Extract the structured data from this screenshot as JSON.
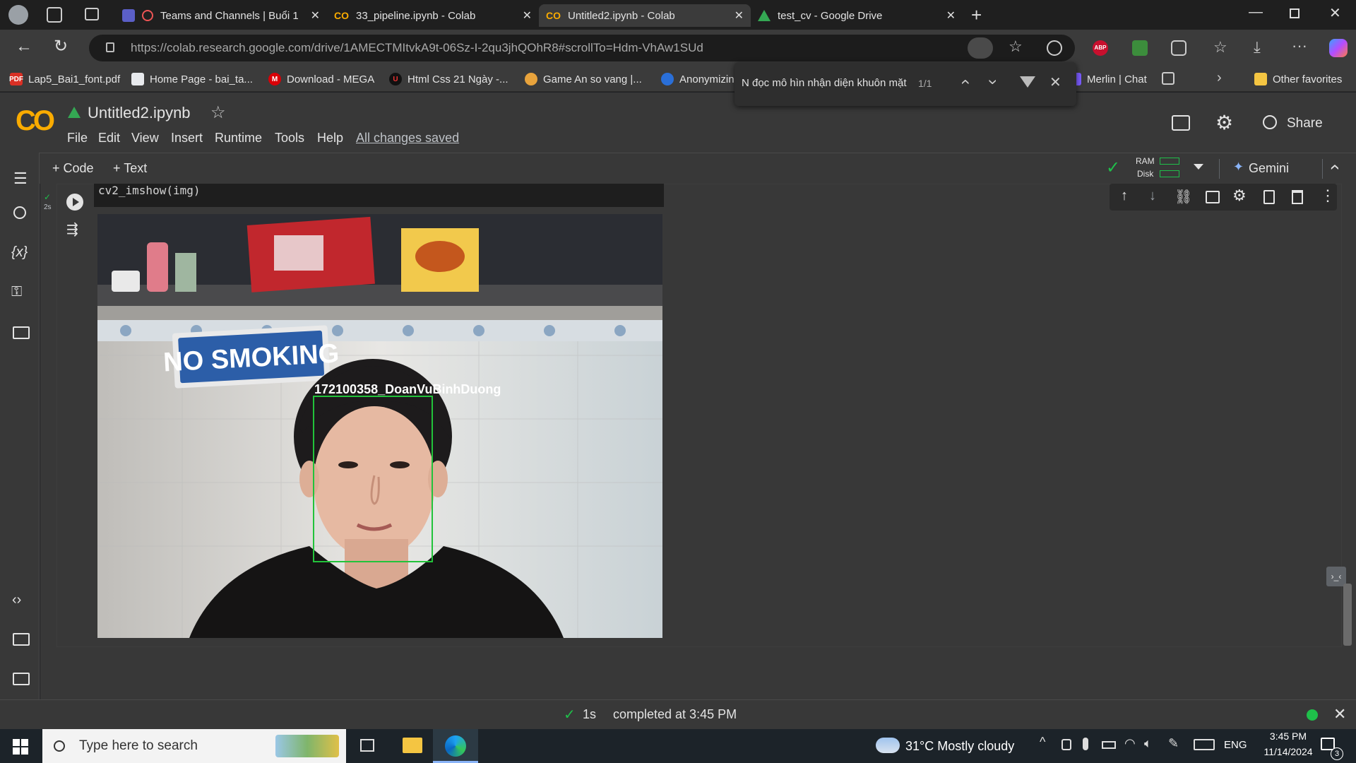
{
  "browser": {
    "tabs": [
      {
        "title": "Teams and Channels | Buổi 1",
        "active": false
      },
      {
        "title": "33_pipeline.ipynb - Colab",
        "active": false
      },
      {
        "title": "Untitled2.ipynb - Colab",
        "active": true
      },
      {
        "title": "test_cv - Google Drive",
        "active": false
      }
    ],
    "url": "https://colab.research.google.com/drive/1AMECTMItvkA9t-06Sz-I-2qu3jhQOhR8#scrollTo=Hdm-VhAw1SUd",
    "bookmarks": [
      {
        "label": "Lap5_Bai1_font.pdf",
        "icon": "pdf-icon"
      },
      {
        "label": "Home Page - bai_ta...",
        "icon": "page-icon"
      },
      {
        "label": "Download - MEGA",
        "icon": "mega-icon"
      },
      {
        "label": "Html Css 21 Ngày -...",
        "icon": "u-icon"
      },
      {
        "label": "Game An so vang |...",
        "icon": "game-icon"
      },
      {
        "label": "Anonymizin",
        "icon": "lock-icon"
      },
      {
        "label": "Merlin | Chat",
        "icon": "merlin-icon"
      }
    ],
    "other_favorites": "Other favorites"
  },
  "find": {
    "query": "N đọc mô hìn nhận diện khuôn mặt",
    "count": "1/1"
  },
  "colab": {
    "logo": "CO",
    "notebook_title": "Untitled2.ipynb",
    "menu": [
      "File",
      "Edit",
      "View",
      "Insert",
      "Runtime",
      "Tools",
      "Help"
    ],
    "saved_status": "All changes saved",
    "share_label": "Share",
    "add_code": "+ Code",
    "add_text": "+ Text",
    "ram_label": "RAM",
    "disk_label": "Disk",
    "gemini_label": "Gemini",
    "cell_code": "cv2_imshow(img)",
    "exec_time": "2s",
    "output_label": "172100358_DoanVuBinhDuong",
    "sign_text": "NO SMOKING"
  },
  "status_bar": {
    "duration": "1s",
    "message": "completed at 3:45 PM"
  },
  "taskbar": {
    "search_placeholder": "Type here to search",
    "weather": "31°C  Mostly cloudy",
    "lang": "ENG",
    "time": "3:45 PM",
    "date": "11/14/2024",
    "notif_count": "3"
  },
  "colors": {
    "colab_orange": "#f9ab00",
    "accent_blue": "#8ab4f8",
    "face_box": "#22c33a",
    "status_green": "#1fbf4a"
  }
}
